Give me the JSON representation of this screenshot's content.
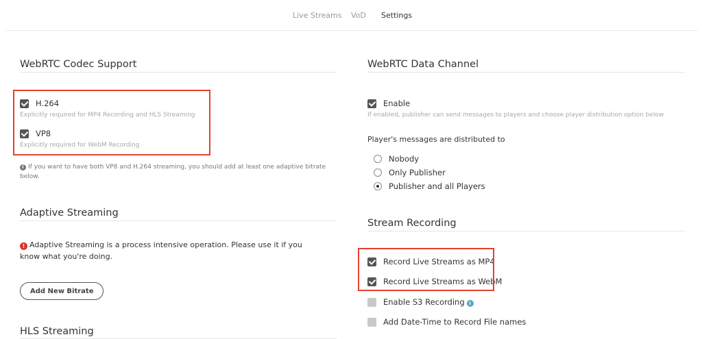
{
  "nav": {
    "tabs": [
      {
        "label": "Live Streams"
      },
      {
        "label": "VoD"
      },
      {
        "label": "Settings"
      }
    ]
  },
  "codec": {
    "title": "WebRTC Codec Support",
    "h264_label": "H.264",
    "h264_help": "Explicitly required for MP4 Recording and HLS Streaming",
    "vp8_label": "VP8",
    "vp8_help": "Explicitly required for WebM Recording",
    "note_line1": "If you want to have both VP8 and H.264 streaming, you should add at least one adaptive bitrate",
    "note_line2": "below."
  },
  "adaptive": {
    "title": "Adaptive Streaming",
    "warning_line1": "Adaptive Streaming is a process intensive operation. Please use it if you",
    "warning_line2": "know what you're doing.",
    "add_button": "Add New Bitrate"
  },
  "hls": {
    "title": "HLS Streaming"
  },
  "data_channel": {
    "title": "WebRTC Data Channel",
    "enable_label": "Enable",
    "enable_help": "If enabled, publisher can send messages to players and choose player distribution option below",
    "distribution_label": "Player's messages are distributed to",
    "options": [
      {
        "label": "Nobody"
      },
      {
        "label": "Only Publisher"
      },
      {
        "label": "Publisher and all Players"
      }
    ],
    "selected": "Publisher and all Players"
  },
  "recording": {
    "title": "Stream Recording",
    "mp4_label": "Record Live Streams as MP4",
    "webm_label": "Record Live Streams as WebM",
    "s3_label": "Enable S3 Recording",
    "datetime_label": "Add Date-Time to Record File names"
  },
  "colors": {
    "highlight": "#e0412d",
    "checkbox_checked": "#555555",
    "checkbox_unchecked": "#c8c8c8",
    "warning_icon": "#d9342b",
    "info_icon": "#5aa3c8"
  }
}
